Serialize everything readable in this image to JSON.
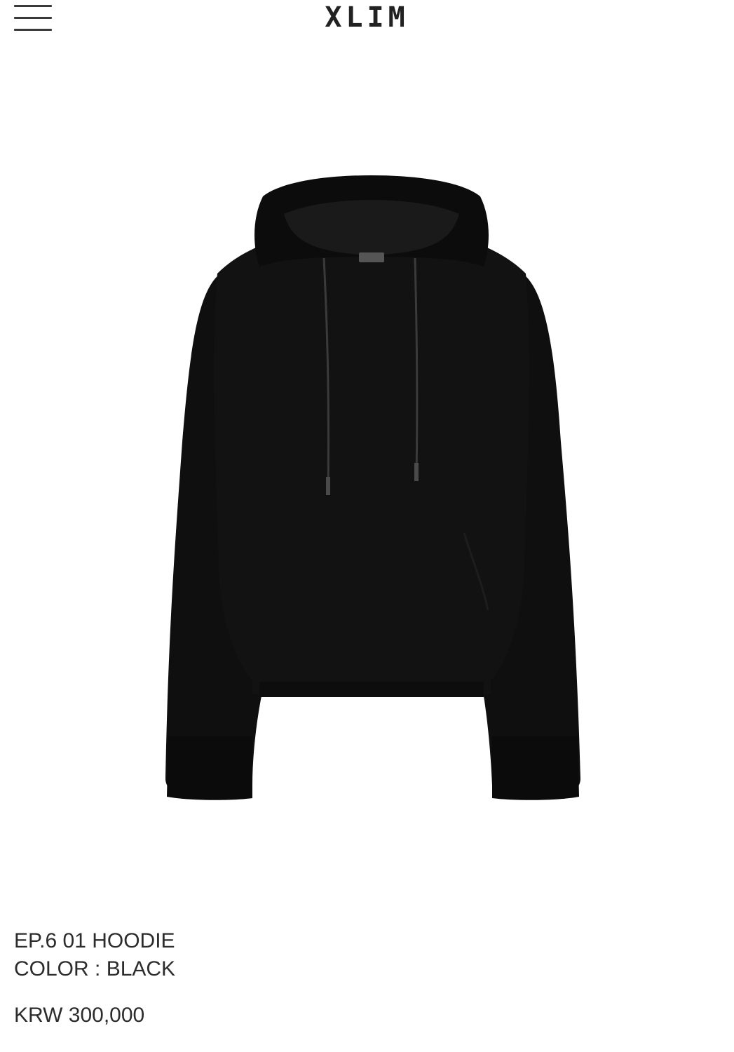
{
  "header": {
    "brand": "XLIM",
    "menu_icon": "hamburger-menu-icon"
  },
  "product": {
    "name": "EP.6 01 HOODIE",
    "color_line": "COLOR : BLACK",
    "price": "KRW 300,000",
    "image_subject": "black hooded sweatshirt",
    "image_color": "#111111"
  }
}
